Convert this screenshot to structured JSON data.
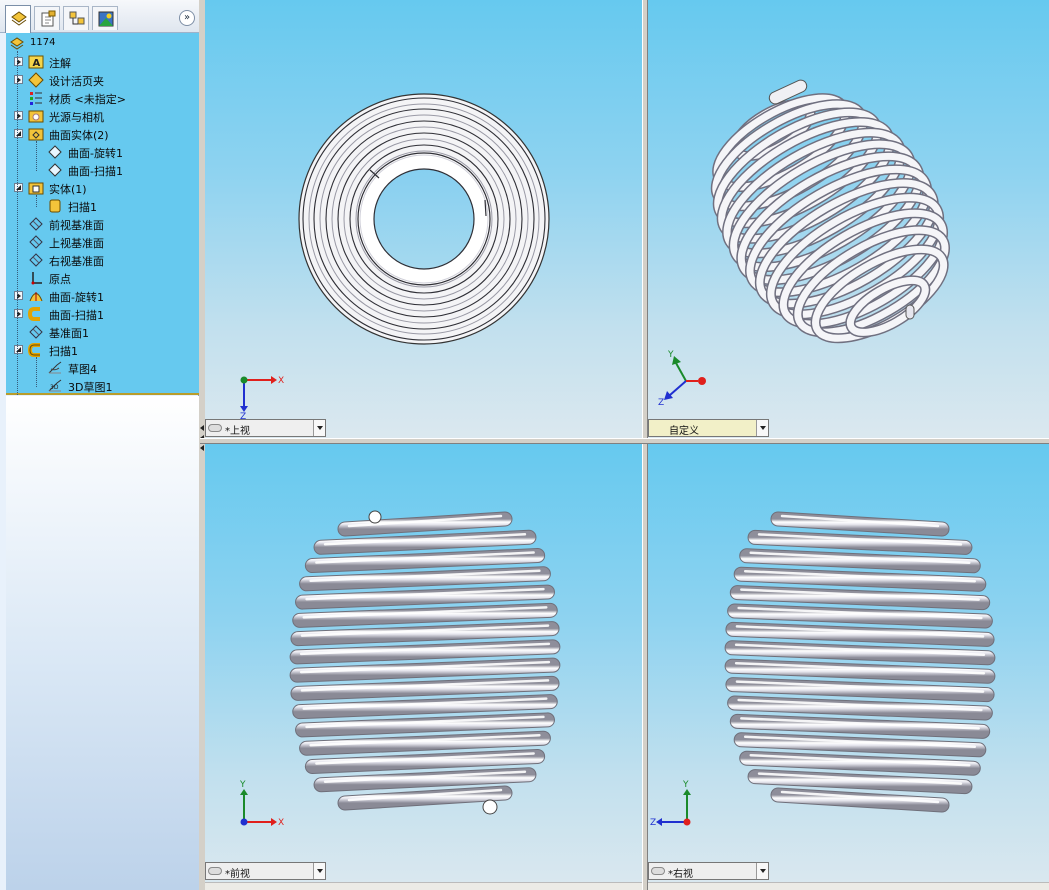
{
  "feature_manager": {
    "tabs": [
      {
        "name": "feature-manager-tab",
        "icon": "feature-tree-icon"
      },
      {
        "name": "property-manager-tab",
        "icon": "property-icon"
      },
      {
        "name": "configuration-manager-tab",
        "icon": "configuration-icon"
      },
      {
        "name": "display-manager-tab",
        "icon": "display-icon"
      }
    ],
    "expand_glyph": "»",
    "tree": [
      {
        "label": "1174",
        "indent": 0,
        "expander": "none",
        "icon": "part-icon"
      },
      {
        "label": "注解",
        "indent": 1,
        "expander": "closed",
        "icon": "annotations-icon"
      },
      {
        "label": "设计活页夹",
        "indent": 1,
        "expander": "closed",
        "icon": "design-binder-icon"
      },
      {
        "label": "材质 <未指定>",
        "indent": 1,
        "expander": "none",
        "icon": "material-icon"
      },
      {
        "label": "光源与相机",
        "indent": 1,
        "expander": "closed",
        "icon": "lights-cameras-icon"
      },
      {
        "label": "曲面实体(2)",
        "indent": 1,
        "expander": "open",
        "icon": "surface-bodies-icon"
      },
      {
        "label": "曲面-旋转1",
        "indent": 2,
        "expander": "none",
        "icon": "surface-body-icon"
      },
      {
        "label": "曲面-扫描1",
        "indent": 2,
        "expander": "none",
        "icon": "surface-body-icon"
      },
      {
        "label": "实体(1)",
        "indent": 1,
        "expander": "open",
        "icon": "solid-bodies-icon"
      },
      {
        "label": "扫描1",
        "indent": 2,
        "expander": "none",
        "icon": "solid-body-icon"
      },
      {
        "label": "前视基准面",
        "indent": 1,
        "expander": "none",
        "icon": "plane-icon"
      },
      {
        "label": "上视基准面",
        "indent": 1,
        "expander": "none",
        "icon": "plane-icon"
      },
      {
        "label": "右视基准面",
        "indent": 1,
        "expander": "none",
        "icon": "plane-icon"
      },
      {
        "label": "原点",
        "indent": 1,
        "expander": "none",
        "icon": "origin-icon"
      },
      {
        "label": "曲面-旋转1",
        "indent": 1,
        "expander": "closed",
        "icon": "revolve-surface-icon"
      },
      {
        "label": "曲面-扫描1",
        "indent": 1,
        "expander": "closed",
        "icon": "sweep-surface-icon"
      },
      {
        "label": "基准面1",
        "indent": 1,
        "expander": "none",
        "icon": "plane-icon"
      },
      {
        "label": "扫描1",
        "indent": 1,
        "expander": "open",
        "icon": "sweep-feature-icon"
      },
      {
        "label": "草图4",
        "indent": 2,
        "expander": "none",
        "icon": "sketch-icon"
      },
      {
        "label": "3D草图1",
        "indent": 2,
        "expander": "none",
        "icon": "sketch-3d-icon"
      }
    ]
  },
  "viewports": {
    "top": {
      "view_name": "*上视",
      "triad": [
        "X",
        "Z"
      ]
    },
    "custom": {
      "view_name": "自定义",
      "triad": [
        "Y",
        "Z"
      ]
    },
    "front": {
      "view_name": "*前视",
      "triad": [
        "Y",
        "X"
      ]
    },
    "right": {
      "view_name": "*右视",
      "triad": [
        "Y",
        "Z"
      ]
    }
  },
  "colors": {
    "viewport_top": "#66c9ef",
    "viewport_bottom": "#dbe8ef",
    "tree_background": "#66c9ef",
    "spring_highlight": "#ffffff",
    "spring_shadow": "#9a9aa6",
    "axis_x": "#e0201c",
    "axis_y": "#1a8a2a",
    "axis_z": "#2030d0"
  }
}
